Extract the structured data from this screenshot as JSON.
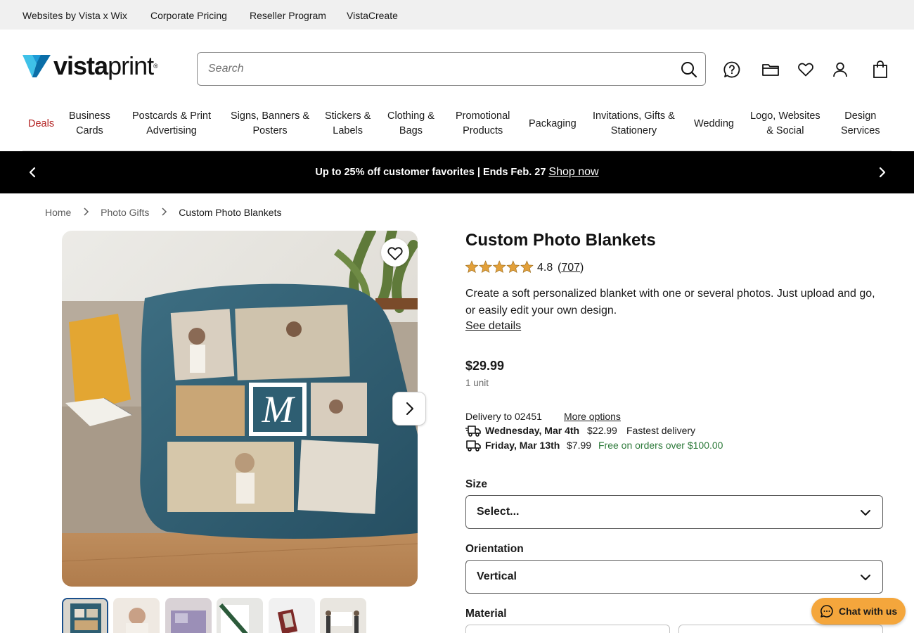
{
  "utility_links": [
    "Websites by Vista x Wix",
    "Corporate Pricing",
    "Reseller Program",
    "VistaCreate"
  ],
  "logo": {
    "text_bold": "vista",
    "text_regular": "print",
    "reg": "®"
  },
  "search": {
    "placeholder": "Search"
  },
  "nav": {
    "deals": "Deals",
    "categories": [
      {
        "line1": "Business",
        "line2": "Cards"
      },
      {
        "line1": "Postcards & Print",
        "line2": "Advertising"
      },
      {
        "line1": "Signs, Banners &",
        "line2": "Posters"
      },
      {
        "line1": "Stickers &",
        "line2": "Labels"
      },
      {
        "line1": "Clothing &",
        "line2": "Bags"
      },
      {
        "line1": "Promotional",
        "line2": "Products"
      },
      {
        "line1": "Packaging",
        "line2": ""
      },
      {
        "line1": "Invitations, Gifts &",
        "line2": "Stationery"
      },
      {
        "line1": "Wedding",
        "line2": ""
      },
      {
        "line1": "Logo, Websites",
        "line2": "& Social"
      },
      {
        "line1": "Design",
        "line2": "Services"
      }
    ]
  },
  "promo": {
    "text": "Up to 25% off customer favorites | Ends Feb. 27",
    "link": "Shop now"
  },
  "breadcrumb": {
    "home": "Home",
    "parent": "Photo Gifts",
    "current": "Custom Photo Blankets"
  },
  "hero": {
    "monogram": "M"
  },
  "product": {
    "title": "Custom Photo Blankets",
    "rating": "4.8",
    "review_count": "707",
    "description": "Create a soft personalized blanket with one or several photos. Just upload and go, or easily edit your own design.",
    "see_details": "See details",
    "price": "$29.99",
    "unit": "1 unit"
  },
  "delivery": {
    "to": "Delivery to 02451",
    "more_options": "More options",
    "options": [
      {
        "date": "Wednesday, Mar 4th",
        "price": "$22.99",
        "note": "Fastest delivery"
      },
      {
        "date": "Friday, Mar 13th",
        "price": "$7.99",
        "note": "Free on orders over $100.00"
      }
    ]
  },
  "options": {
    "size_label": "Size",
    "size_value": "Select...",
    "orientation_label": "Orientation",
    "orientation_value": "Vertical",
    "material_label": "Material"
  },
  "chat": {
    "label": "Chat with us"
  },
  "colors": {
    "deals_red": "#b32121",
    "promo_bg": "#000000",
    "chat_orange": "#f4a63c",
    "free_green": "#2d7a3a",
    "blanket_teal": "#2e5e72"
  }
}
